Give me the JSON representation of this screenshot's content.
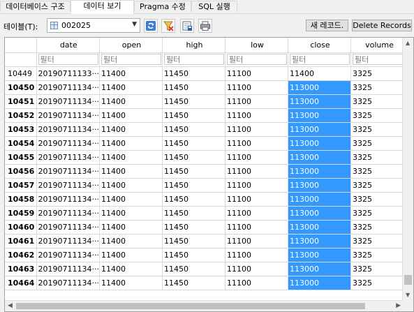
{
  "tabs": [
    {
      "label": "데이터베이스 구조",
      "active": false
    },
    {
      "label": "데이터 보기",
      "active": true
    },
    {
      "label": "Pragma 수정",
      "active": false
    },
    {
      "label": "SQL 실행",
      "active": false
    }
  ],
  "toolbar": {
    "table_label": "테이블(T):",
    "table_value": "002025",
    "icons": [
      "refresh-icon",
      "clear-filter-icon",
      "save-table-icon",
      "print-icon"
    ],
    "new_record_label": "새 레코드.",
    "delete_label": "Delete Records"
  },
  "grid": {
    "columns": [
      "date",
      "open",
      "high",
      "low",
      "close",
      "volume"
    ],
    "filter_placeholder": "필터",
    "rows": [
      [
        "10449",
        "20190711133···",
        "11400",
        "11450",
        "11100",
        "11400",
        "3325"
      ],
      [
        "10450",
        "20190711134···",
        "11400",
        "11450",
        "11100",
        "113000",
        "3325"
      ],
      [
        "10451",
        "20190711134···",
        "11400",
        "11450",
        "11100",
        "113000",
        "3325"
      ],
      [
        "10452",
        "20190711134···",
        "11400",
        "11450",
        "11100",
        "113000",
        "3325"
      ],
      [
        "10453",
        "20190711134···",
        "11400",
        "11450",
        "11100",
        "113000",
        "3325"
      ],
      [
        "10454",
        "20190711134···",
        "11400",
        "11450",
        "11100",
        "113000",
        "3325"
      ],
      [
        "10455",
        "20190711134···",
        "11400",
        "11450",
        "11100",
        "113000",
        "3325"
      ],
      [
        "10456",
        "20190711134···",
        "11400",
        "11450",
        "11100",
        "113000",
        "3325"
      ],
      [
        "10457",
        "20190711134···",
        "11400",
        "11450",
        "11100",
        "113000",
        "3325"
      ],
      [
        "10458",
        "20190711134···",
        "11400",
        "11450",
        "11100",
        "113000",
        "3325"
      ],
      [
        "10459",
        "20190711134···",
        "11400",
        "11450",
        "11100",
        "113000",
        "3325"
      ],
      [
        "10460",
        "20190711134···",
        "11400",
        "11450",
        "11100",
        "113000",
        "3325"
      ],
      [
        "10461",
        "20190711134···",
        "11400",
        "11450",
        "11100",
        "113000",
        "3325"
      ],
      [
        "10462",
        "20190711134···",
        "11400",
        "11450",
        "11100",
        "113000",
        "3325"
      ],
      [
        "10463",
        "20190711134···",
        "11400",
        "11450",
        "11100",
        "113000",
        "3325"
      ],
      [
        "10464",
        "20190711134···",
        "11400",
        "11450",
        "11100",
        "113000",
        "3325"
      ]
    ],
    "selected_column": "close",
    "selected_color": "#3399ff"
  }
}
